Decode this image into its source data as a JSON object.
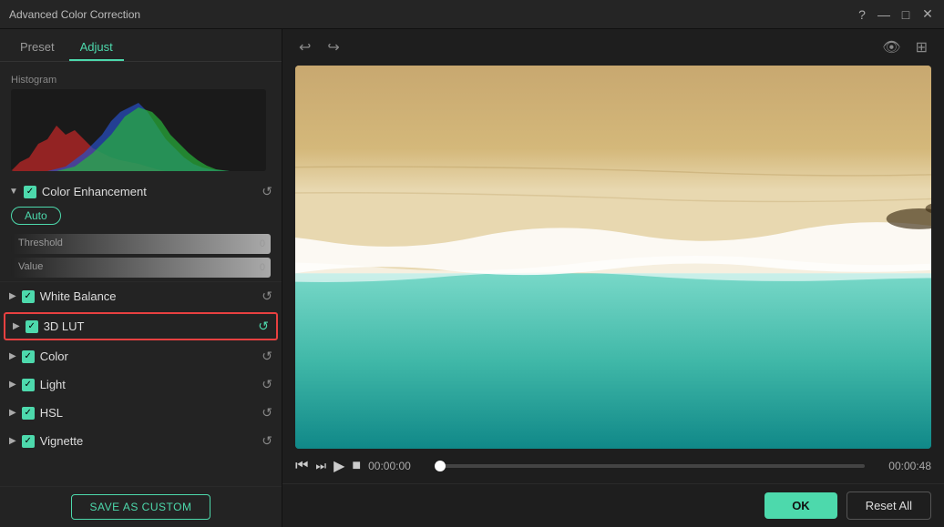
{
  "titlebar": {
    "title": "Advanced Color Correction",
    "help_icon": "?",
    "minimize_icon": "—",
    "maximize_icon": "□",
    "close_icon": "✕"
  },
  "tabs": [
    {
      "id": "preset",
      "label": "Preset",
      "active": false
    },
    {
      "id": "adjust",
      "label": "Adjust",
      "active": true
    }
  ],
  "histogram": {
    "label": "Histogram"
  },
  "color_enhancement": {
    "name": "Color Enhancement",
    "threshold_label": "Threshold",
    "threshold_value": "0",
    "value_label": "Value",
    "value_value": "0",
    "auto_label": "Auto"
  },
  "sections": [
    {
      "id": "white-balance",
      "label": "White Balance",
      "checked": true,
      "highlighted": false
    },
    {
      "id": "3d-lut",
      "label": "3D LUT",
      "checked": true,
      "highlighted": true
    },
    {
      "id": "color",
      "label": "Color",
      "checked": true,
      "highlighted": false
    },
    {
      "id": "light",
      "label": "Light",
      "checked": true,
      "highlighted": false
    },
    {
      "id": "hsl",
      "label": "HSL",
      "checked": true,
      "highlighted": false
    },
    {
      "id": "vignette",
      "label": "Vignette",
      "checked": true,
      "highlighted": false
    }
  ],
  "bottom": {
    "save_custom_label": "SAVE AS CUSTOM"
  },
  "toolbar": {
    "undo_icon": "↩",
    "redo_icon": "↪",
    "eye_icon": "👁",
    "compare_icon": "⊞"
  },
  "playback": {
    "rewind_icon": "⏮",
    "step_back_icon": "⏭",
    "play_icon": "▶",
    "stop_icon": "■",
    "time_start": "00:00:00",
    "time_end": "00:00:48",
    "progress": 0
  },
  "actions": {
    "ok_label": "OK",
    "reset_all_label": "Reset All"
  },
  "colors": {
    "accent": "#4dd9ac",
    "highlight_border": "#e84040",
    "bg_dark": "#232323",
    "bg_darker": "#1a1a1a"
  }
}
